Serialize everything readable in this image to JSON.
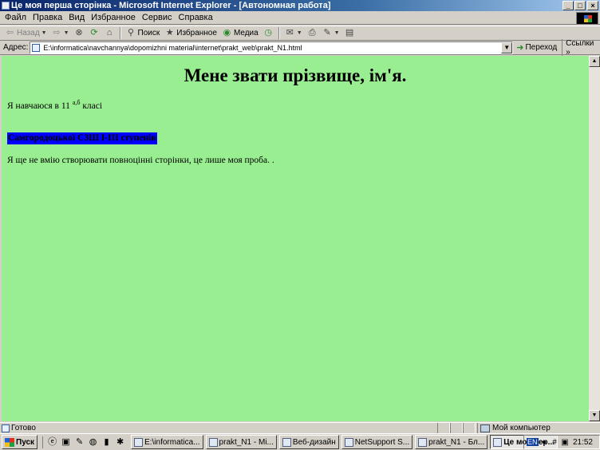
{
  "window": {
    "title": "Це моя перша сторінка - Microsoft Internet Explorer - [Автономная работа]",
    "controls": {
      "minimize": "_",
      "maximize": "□",
      "close": "×"
    }
  },
  "menu": [
    "Файл",
    "Правка",
    "Вид",
    "Избранное",
    "Сервис",
    "Справка"
  ],
  "toolbar": {
    "back_label": "Назад",
    "search_label": "Поиск",
    "favorites_label": "Избранное",
    "media_label": "Медиа"
  },
  "address": {
    "label": "Адрес:",
    "url": "E:\\informatica\\navchannya\\dopomizhni material\\internet\\prakt_web\\prakt_N1.html",
    "go_label": "Переход",
    "links_label": "Ссылки",
    "links_more": "»"
  },
  "page": {
    "background": "#98ee90",
    "heading": "Мене звати прізвище, ім'я.",
    "line1_before": "Я навчаюся в 11",
    "line1_sup": "а,б",
    "line1_after": "класі",
    "school": "Самгородоцької СЗШ І-ІІІ ступенів",
    "school_bg": "#0000ff",
    "line3": "Я ще не вмію створювати повноцінні сторінки, це лише моя проба. ."
  },
  "status": {
    "text": "Готово",
    "zone": "Мой компьютер"
  },
  "taskbar": {
    "start_label": "Пуск",
    "tasks": [
      {
        "label": "E:\\informatica...",
        "icon": "folder-icon",
        "active": false
      },
      {
        "label": "prakt_N1 - Mi...",
        "icon": "word-icon",
        "active": false
      },
      {
        "label": "Веб-дизайн",
        "icon": "folder-icon",
        "active": false
      },
      {
        "label": "NetSupport S...",
        "icon": "netsupport-icon",
        "active": false
      },
      {
        "label": "prakt_N1 - Бл...",
        "icon": "notepad-icon",
        "active": false
      },
      {
        "label": "Це моя пер...",
        "icon": "ie-icon",
        "active": true
      }
    ],
    "tray": {
      "lang": "EN",
      "clock": "21:52"
    }
  }
}
